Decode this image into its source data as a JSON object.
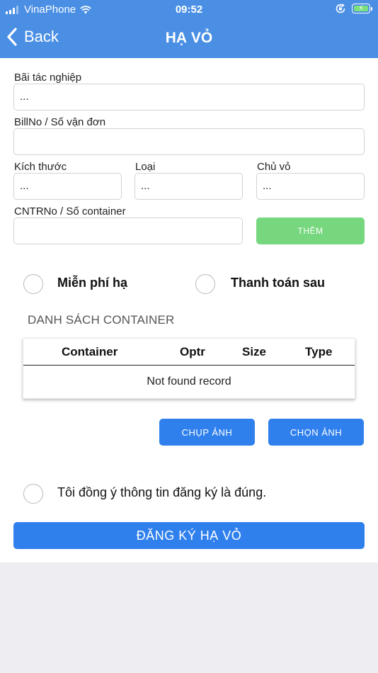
{
  "status_bar": {
    "carrier": "VinaPhone",
    "time": "09:52",
    "signal_bars_filled": 3,
    "signal_bars_total": 4
  },
  "nav": {
    "back_label": "Back",
    "title": "HẠ VỎ"
  },
  "form": {
    "bai_tac_nghiep": {
      "label": "Bãi tác nghiệp",
      "value": "..."
    },
    "bill_no": {
      "label": "BillNo / Số vận đơn",
      "value": ""
    },
    "kich_thuoc": {
      "label": "Kích thước",
      "value": "..."
    },
    "loai": {
      "label": "Loại",
      "value": "..."
    },
    "chu_vo": {
      "label": "Chủ vỏ",
      "value": "..."
    },
    "cntr_no": {
      "label": "CNTRNo / Số container",
      "value": ""
    },
    "add_button": "THÊM"
  },
  "options": {
    "free": "Miễn phí hạ",
    "pay_later": "Thanh toán sau"
  },
  "container_list": {
    "title": "DANH SÁCH CONTAINER",
    "columns": [
      "Container",
      "Optr",
      "Size",
      "Type"
    ],
    "empty_text": "Not found record"
  },
  "photo_buttons": {
    "take": "CHỤP ẢNH",
    "choose": "CHỌN ẢNH"
  },
  "agree_text": "Tôi đồng ý thông tin đăng ký là đúng.",
  "submit_label": "ĐĂNG KÝ HẠ VỎ",
  "colors": {
    "header": "#4a8fe4",
    "primary_button": "#2f80ed",
    "add_button": "#77d77f",
    "background": "#ededf2"
  }
}
